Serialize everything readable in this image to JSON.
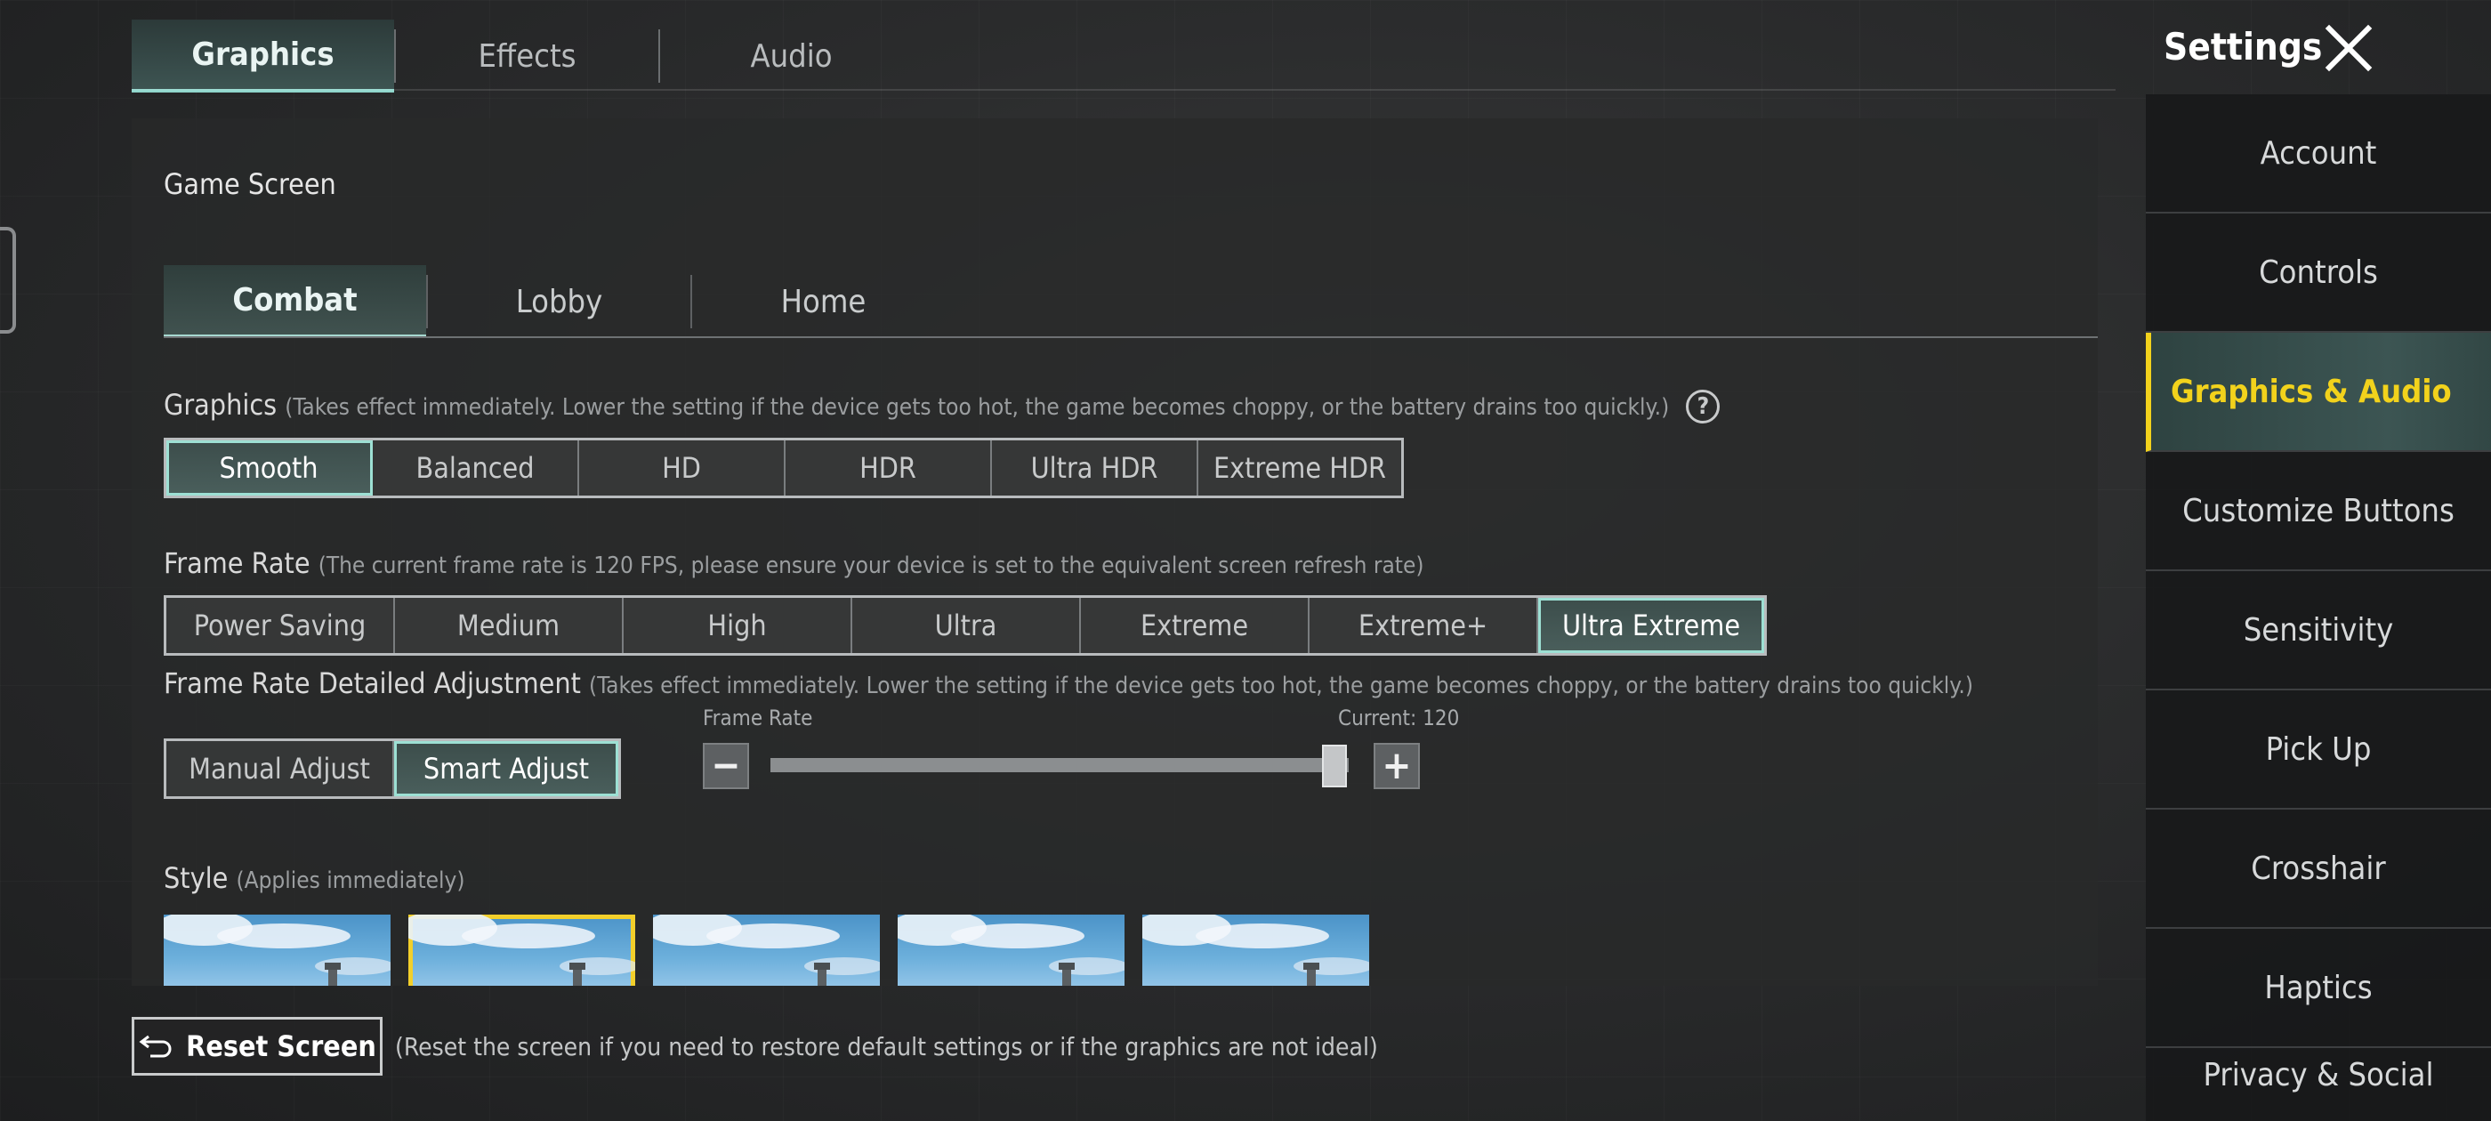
{
  "top_tabs": [
    {
      "label": "Graphics",
      "active": true
    },
    {
      "label": "Effects",
      "active": false
    },
    {
      "label": "Audio",
      "active": false
    }
  ],
  "header": {
    "title": "Settings",
    "close_icon": "close-icon"
  },
  "section": {
    "title": "Game Screen"
  },
  "sub_tabs": [
    {
      "label": "Combat",
      "active": true
    },
    {
      "label": "Lobby",
      "active": false
    },
    {
      "label": "Home",
      "active": false
    }
  ],
  "graphics": {
    "label": "Graphics",
    "hint": "(Takes effect immediately. Lower the setting if the device gets too hot, the game becomes choppy, or the battery drains too quickly.)",
    "help_icon": "?",
    "options": [
      "Smooth",
      "Balanced",
      "HD",
      "HDR",
      "Ultra HDR",
      "Extreme HDR"
    ],
    "selected": "Smooth"
  },
  "frame_rate": {
    "label": "Frame Rate",
    "hint": "(The current frame rate is 120 FPS, please ensure your device is set to the equivalent screen refresh rate)",
    "options": [
      "Power Saving",
      "Medium",
      "High",
      "Ultra",
      "Extreme",
      "Extreme+",
      "Ultra Extreme"
    ],
    "selected": "Ultra Extreme"
  },
  "frame_rate_adjust": {
    "label": "Frame Rate Detailed Adjustment",
    "hint": "(Takes effect immediately. Lower the setting if the device gets too hot, the game becomes choppy, or the battery drains too quickly.)",
    "modes": [
      "Manual Adjust",
      "Smart Adjust"
    ],
    "selected": "Smart Adjust",
    "slider_label": "Frame Rate",
    "current_label": "Current: 120",
    "minus": "−",
    "plus": "+",
    "slider_fraction": 1.0
  },
  "style": {
    "label": "Style",
    "hint": "(Applies immediately)",
    "selected_index": 1,
    "count": 5
  },
  "reset": {
    "label": "Reset Screen",
    "hint": "(Reset the screen if you need to restore default settings or if the graphics are not ideal)"
  },
  "sidebar": {
    "items": [
      {
        "label": "Account"
      },
      {
        "label": "Controls"
      },
      {
        "label": "Graphics & Audio",
        "active": true
      },
      {
        "label": "Customize Buttons"
      },
      {
        "label": "Sensitivity"
      },
      {
        "label": "Pick Up"
      },
      {
        "label": "Crosshair"
      },
      {
        "label": "Haptics"
      },
      {
        "label": "Privacy & Social"
      }
    ]
  },
  "colors": {
    "accent_teal": "#8fd6cc",
    "active_yellow": "#f2d21c",
    "style_selected": "#f2cf2b"
  }
}
